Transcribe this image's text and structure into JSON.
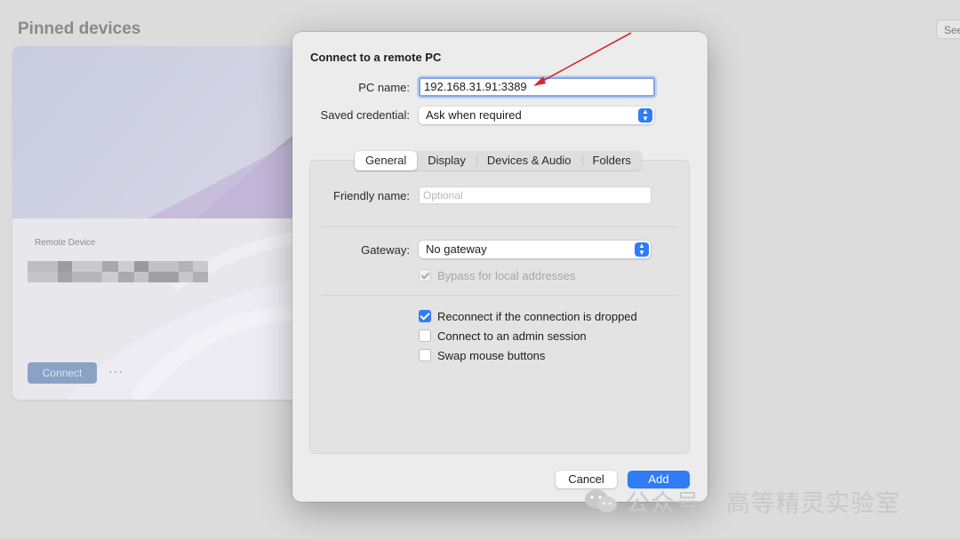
{
  "background": {
    "title": "Pinned devices",
    "see_button": "See",
    "card": {
      "label": "Remote Device",
      "connect_label": "Connect",
      "more_label": "···"
    }
  },
  "dialog": {
    "title": "Connect to a remote PC",
    "pc_name": {
      "label": "PC name:",
      "value": "192.168.31.91:3389"
    },
    "saved_credential": {
      "label": "Saved credential:",
      "value": "Ask when required"
    },
    "tabs": [
      "General",
      "Display",
      "Devices & Audio",
      "Folders"
    ],
    "friendly_name": {
      "label": "Friendly name:",
      "placeholder": "Optional"
    },
    "gateway": {
      "label": "Gateway:",
      "value": "No gateway"
    },
    "bypass": {
      "label": "Bypass for local addresses",
      "checked": true,
      "enabled": false
    },
    "options": [
      {
        "label": "Reconnect if the connection is dropped",
        "checked": true
      },
      {
        "label": "Connect to an admin session",
        "checked": false
      },
      {
        "label": "Swap mouse buttons",
        "checked": false
      }
    ],
    "cancel_label": "Cancel",
    "add_label": "Add"
  },
  "watermark": {
    "text": "公众号 · 高等精灵实验室"
  },
  "colors": {
    "accent": "#2f7cf6",
    "annotation_arrow": "#d42a2a"
  }
}
